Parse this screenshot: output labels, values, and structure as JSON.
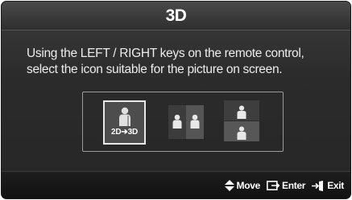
{
  "dialog": {
    "title": "3D",
    "instruction_line1": "Using the LEFT / RIGHT keys on the remote control,",
    "instruction_line2": "select the icon suitable for the picture on screen."
  },
  "modes": [
    {
      "icon": "2d-to-3d-icon",
      "label": "2D➔3D",
      "selected": true
    },
    {
      "icon": "side-by-side-icon",
      "selected": false
    },
    {
      "icon": "top-and-bottom-icon",
      "selected": false
    }
  ],
  "footer": {
    "move_label": "Move",
    "enter_label": "Enter",
    "exit_label": "Exit"
  },
  "colors": {
    "background": "#2b2b2b",
    "selection_border": "#e8e8e8",
    "text": "#ffffff"
  }
}
